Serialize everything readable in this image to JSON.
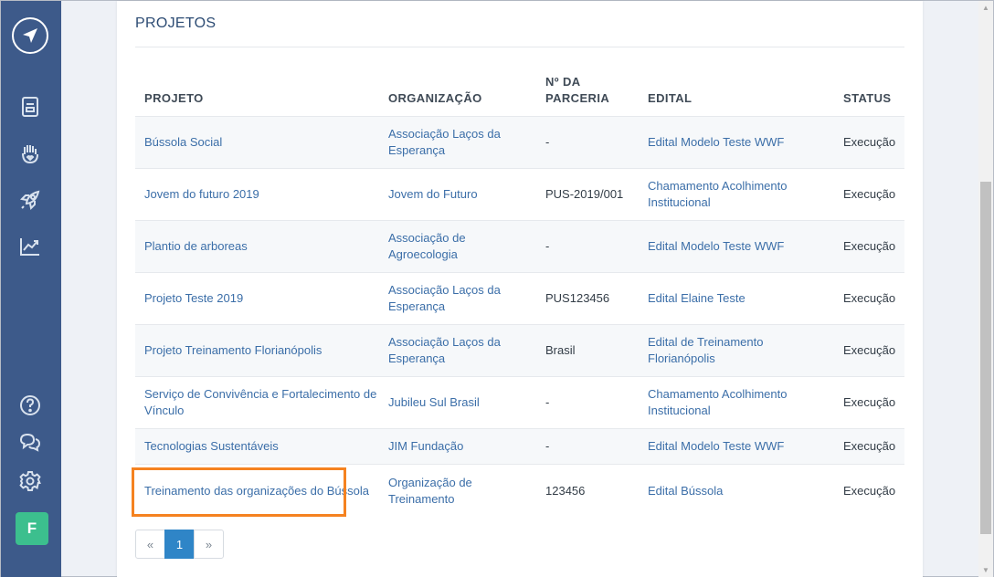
{
  "section_title": "PROJETOS",
  "columns": {
    "projeto": "PROJETO",
    "organizacao": "ORGANIZAÇÃO",
    "parceria_line1": "Nº DA",
    "parceria_line2": "PARCERIA",
    "edital": "EDITAL",
    "status": "STATUS"
  },
  "rows": [
    {
      "projeto": "Bússola Social",
      "organizacao": "Associação Laços da Esperança",
      "parceria": "-",
      "edital": "Edital Modelo Teste WWF",
      "status": "Execução"
    },
    {
      "projeto": "Jovem do futuro 2019",
      "organizacao": "Jovem do Futuro",
      "parceria": "PUS-2019/001",
      "edital": "Chamamento Acolhimento Institucional",
      "status": "Execução"
    },
    {
      "projeto": "Plantio de arboreas",
      "organizacao": "Associação de Agroecologia",
      "parceria": "-",
      "edital": "Edital Modelo Teste WWF",
      "status": "Execução"
    },
    {
      "projeto": "Projeto Teste 2019",
      "organizacao": "Associação Laços da Esperança",
      "parceria": "PUS123456",
      "edital": "Edital Elaine Teste",
      "status": "Execução"
    },
    {
      "projeto": "Projeto Treinamento Florianópolis",
      "organizacao": "Associação Laços da Esperança",
      "parceria": "Brasil",
      "edital": "Edital de Treinamento Florianópolis",
      "status": "Execução"
    },
    {
      "projeto": "Serviço de Convivência e Fortalecimento de Vínculo",
      "organizacao": "Jubileu Sul Brasil",
      "parceria": "-",
      "edital": "Chamamento Acolhimento Institucional",
      "status": "Execução"
    },
    {
      "projeto": "Tecnologias Sustentáveis",
      "organizacao": "JIM Fundação",
      "parceria": "-",
      "edital": "Edital Modelo Teste WWF",
      "status": "Execução"
    },
    {
      "projeto": "Treinamento das organizações do Bússola",
      "organizacao": "Organização de Treinamento",
      "parceria": "123456",
      "edital": "Edital Bússola",
      "status": "Execução"
    }
  ],
  "pagination": {
    "prev": "«",
    "current": "1",
    "next": "»"
  },
  "user": {
    "avatar_letter": "F"
  },
  "colors": {
    "sidebar": "#3d5a8a",
    "link": "#3b6ea8",
    "highlight": "#f58220",
    "active_page": "#2f85c7",
    "avatar": "#3cbf8e"
  },
  "sidebar_icons": [
    "compass-logo-icon",
    "document-icon",
    "hand-heart-icon",
    "rocket-icon",
    "chart-icon",
    "help-icon",
    "chat-icon",
    "gear-icon"
  ]
}
